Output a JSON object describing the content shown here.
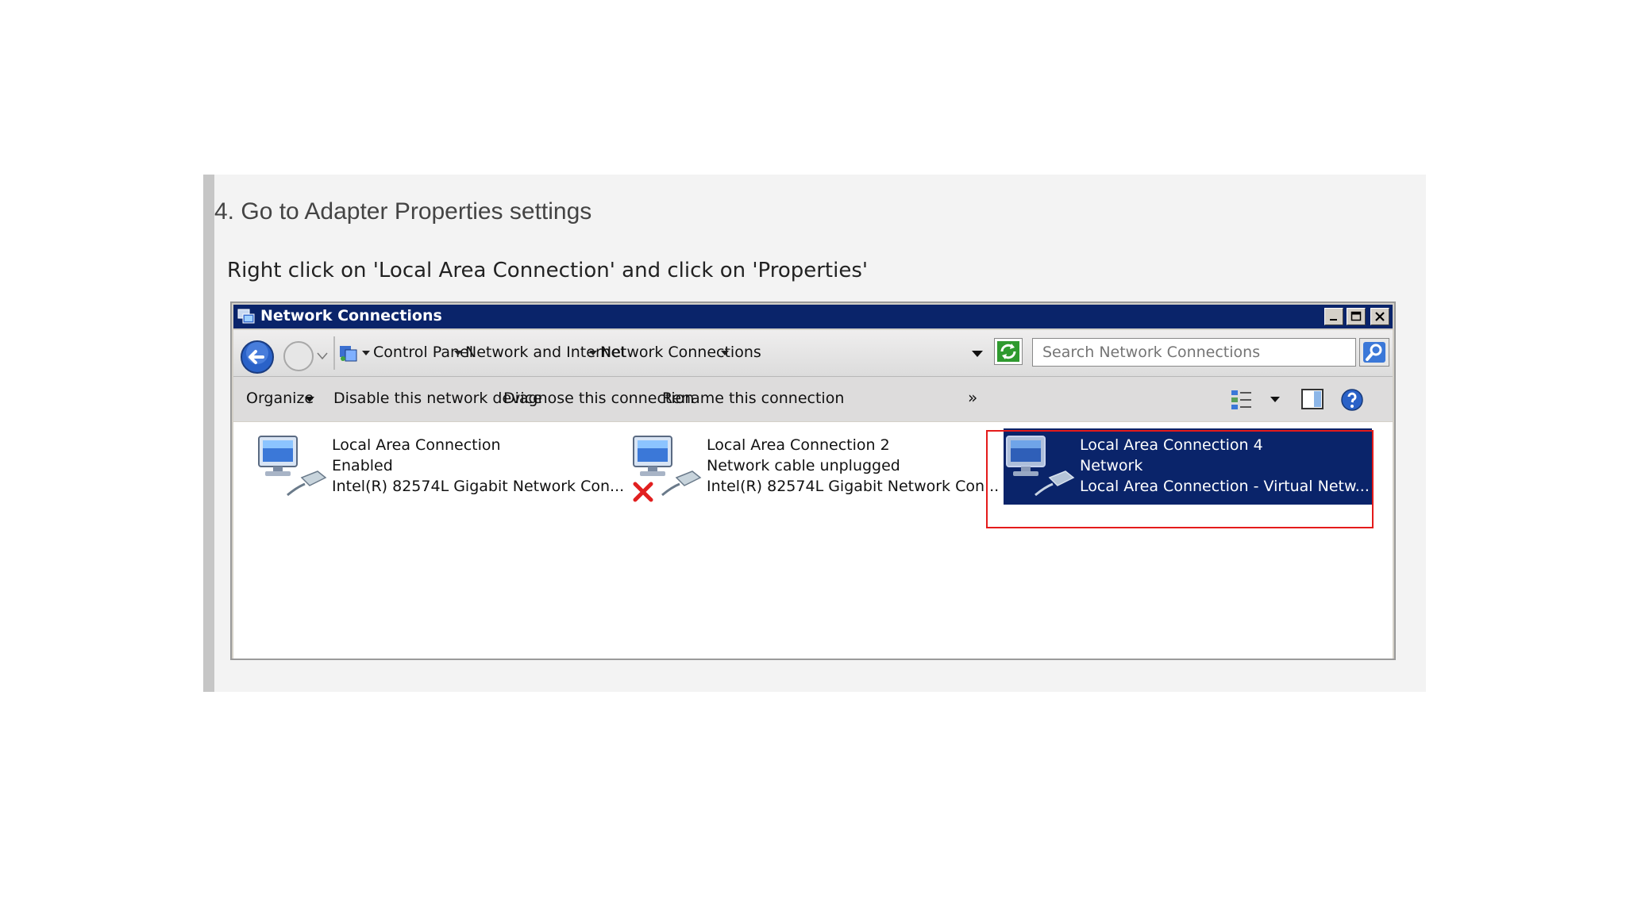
{
  "tutorial": {
    "step_heading": "4. Go to Adapter Properties settings",
    "step_instruction": "Right click on 'Local Area Connection' and click on 'Properties'"
  },
  "window": {
    "title": "Network Connections",
    "colors": {
      "titlebar": "#0a246a",
      "selection": "#0a246a",
      "highlight": "#e41b1b"
    }
  },
  "address_bar": {
    "breadcrumbs": [
      "Control Panel",
      "Network and Internet",
      "Network Connections"
    ],
    "search_placeholder": "Search Network Connections"
  },
  "toolbar": {
    "organize": "Organize",
    "disable": "Disable this network device",
    "diagnose": "Diagnose this connection",
    "rename": "Rename this connection",
    "more": "»"
  },
  "connections": [
    {
      "name": "Local Area Connection",
      "status": "Enabled",
      "device": "Intel(R) 82574L Gigabit Network Con...",
      "unplugged": false,
      "selected": false
    },
    {
      "name": "Local Area Connection 2",
      "status": "Network cable unplugged",
      "device": "Intel(R) 82574L Gigabit Network Con...",
      "unplugged": true,
      "selected": false
    },
    {
      "name": "Local Area Connection 4",
      "status": "Network",
      "device": "Local Area Connection - Virtual Netw...",
      "unplugged": false,
      "selected": true
    }
  ]
}
